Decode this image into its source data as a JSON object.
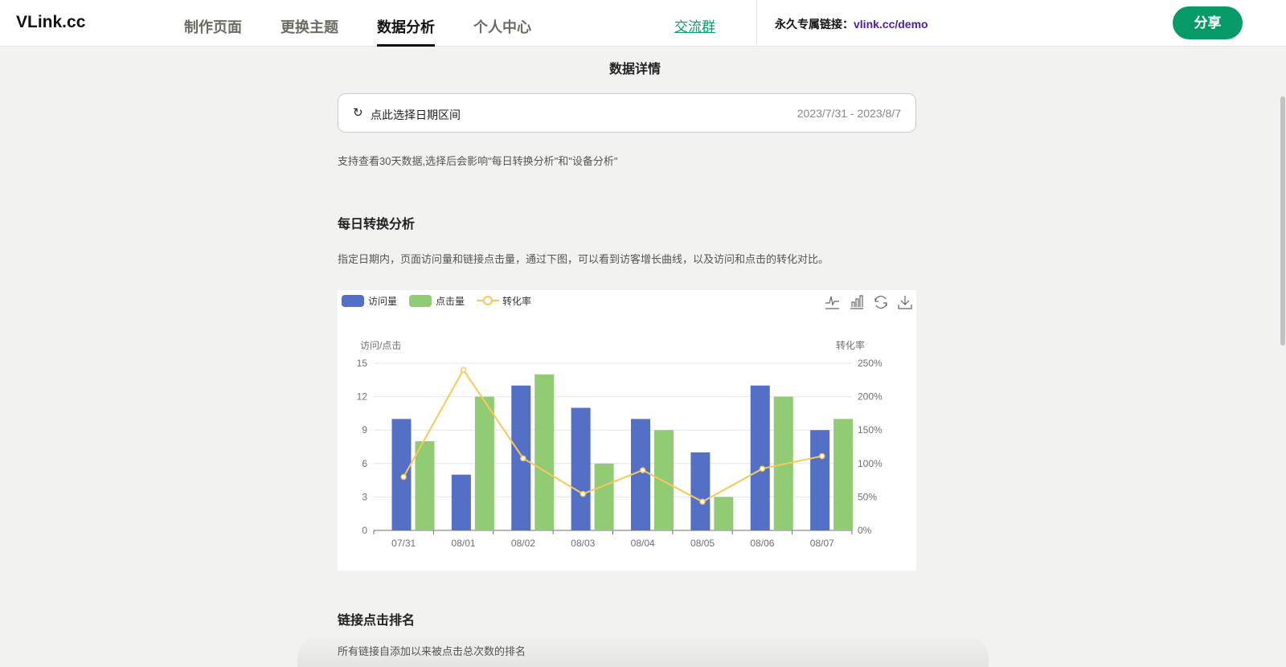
{
  "header": {
    "logo": "VLink.cc",
    "nav": [
      "制作页面",
      "更换主题",
      "数据分析",
      "个人中心"
    ],
    "active": "数据分析",
    "group": "交流群",
    "perm_label": "永久专属链接：",
    "perm_link": "vlink.cc/demo",
    "share": "分享"
  },
  "page_title": "数据详情",
  "date_picker": {
    "label": "点此选择日期区间",
    "value": "2023/7/31 - 2023/8/7"
  },
  "date_note": "支持查看30天数据,选择后会影响\"每日转换分析\"和\"设备分析\"",
  "daily": {
    "title": "每日转换分析",
    "desc": "指定日期内，页面访问量和链接点击量，通过下图，可以看到访客增长曲线，以及访问和点击的转化对比。"
  },
  "ranking": {
    "title": "链接点击排名",
    "desc": "所有链接自添加以来被点击总次数的排名"
  },
  "colors": {
    "visits": "#5470c6",
    "clicks": "#91cc75",
    "rate": "#fac858"
  },
  "chart_data": {
    "type": "bar",
    "categories": [
      "07/31",
      "08/01",
      "08/02",
      "08/03",
      "08/04",
      "08/05",
      "08/06",
      "08/07"
    ],
    "series": [
      {
        "name": "访问量",
        "type": "bar",
        "axis": "left",
        "values": [
          10,
          5,
          13,
          11,
          10,
          7,
          13,
          9
        ]
      },
      {
        "name": "点击量",
        "type": "bar",
        "axis": "left",
        "values": [
          8,
          12,
          14,
          6,
          9,
          3,
          12,
          10
        ]
      },
      {
        "name": "转化率",
        "type": "line",
        "axis": "right",
        "values": [
          80,
          240,
          107.7,
          54.5,
          90,
          42.9,
          92.3,
          111.1
        ]
      }
    ],
    "ylabel": "访问/点击",
    "y2label": "转化率",
    "ylim": [
      0,
      15
    ],
    "yticks": [
      "0",
      "3",
      "6",
      "9",
      "12",
      "15"
    ],
    "y2lim": [
      0,
      250
    ],
    "y2ticks": [
      "0%",
      "50%",
      "100%",
      "150%",
      "200%",
      "250%"
    ],
    "legend": "top-left",
    "grid": true
  }
}
